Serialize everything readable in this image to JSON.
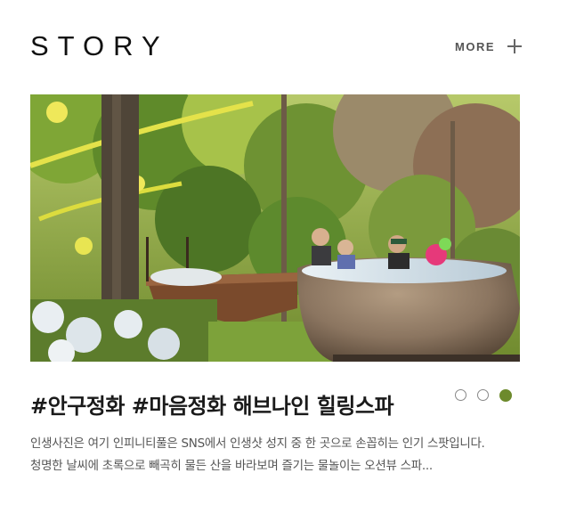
{
  "header": {
    "title": "STORY",
    "more_label": "MORE",
    "more_icon": "plus-icon"
  },
  "story": {
    "image_alt": "Outdoor hot tub in a stone basin surrounded by forest with people bathing",
    "title": "#안구정화 #마음정화 해브나인 힐링스파",
    "description_lines": [
      "인생사진은 여기 인피니티풀은 SNS에서 인생샷 성지 중 한 곳으로 손꼽히는 인기 스팟입니다.",
      "청명한 날씨에 초록으로 빼곡히 물든 산을 바라보며 즐기는 물놀이는 오션뷰 스파..."
    ]
  },
  "pager": {
    "count": 3,
    "active_index": 2,
    "active_color": "#6d8a2c"
  }
}
